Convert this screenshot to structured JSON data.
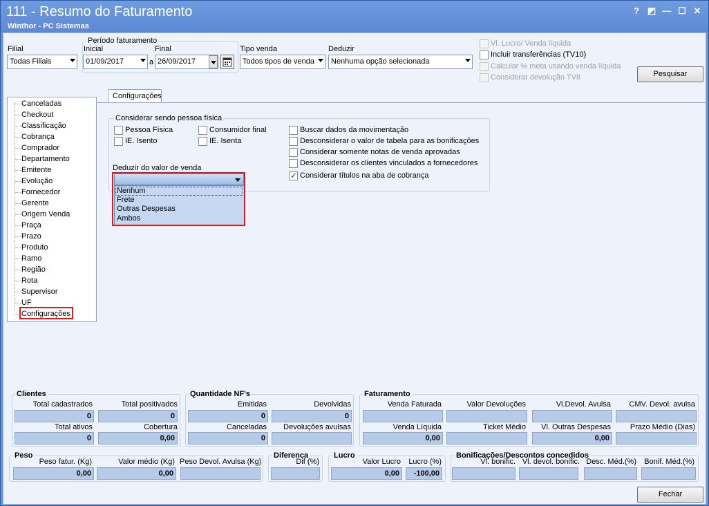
{
  "window": {
    "title": "111 - Resumo do Faturamento",
    "subtitle": "Winthor - PC Sistemas",
    "controls": [
      "?",
      "◩",
      "—",
      "☐",
      "✕"
    ]
  },
  "filters": {
    "filial_label": "Filial",
    "filial_value": "Todas Filiais",
    "periodo_label": "Período faturamento",
    "inicial_label": "Inicial",
    "inicial_value": "01/09/2017",
    "a_label": "a",
    "final_label": "Final",
    "final_value": "26/09/2017",
    "tipo_venda_label": "Tipo venda",
    "tipo_venda_value": "Todos tipos de venda",
    "deduzir_label": "Deduzir",
    "deduzir_value": "Nenhuma opção selecionada",
    "checks": [
      {
        "label": "Vl. Lucro/ Venda líquida",
        "checked": false,
        "enabled": false
      },
      {
        "label": "Incluir transferências  (TV10)",
        "checked": false,
        "enabled": true
      },
      {
        "label": "Calcular % meta usando venda líquida",
        "checked": false,
        "enabled": false
      },
      {
        "label": "Considerar devolução TV8",
        "checked": false,
        "enabled": false
      }
    ],
    "pesquisar_label": "Pesquisar"
  },
  "tree": {
    "items": [
      "Canceladas",
      "Checkout",
      "Classificação",
      "Cobrança",
      "Comprador",
      "Departamento",
      "Emitente",
      "Evolução",
      "Fornecedor",
      "Gerente",
      "Origem Venda",
      "Praça",
      "Prazo",
      "Produto",
      "Ramo",
      "Região",
      "Rota",
      "Supervisor",
      "UF",
      "Configurações"
    ],
    "selected": "Configurações"
  },
  "config": {
    "tab_label": "Configurações",
    "pessoa_group_label": "Considerar sendo pessoa física",
    "pessoa_checks": [
      {
        "label": "Pessoa Física",
        "checked": false
      },
      {
        "label": "Consumidor final",
        "checked": false
      },
      {
        "label": "IE. Isento",
        "checked": false
      },
      {
        "label": "IE. Isenta",
        "checked": false
      }
    ],
    "right_checks": [
      {
        "label": "Buscar dados da movimentação",
        "checked": false
      },
      {
        "label": "Desconsiderar o valor de tabela para as bonificações",
        "checked": false
      },
      {
        "label": "Considerar somente notas de venda aprovadas",
        "checked": false
      },
      {
        "label": "Desconsiderar os clientes vinculados a fornecedores",
        "checked": false
      },
      {
        "label": "Considerar títulos na aba de cobrança",
        "checked": true
      }
    ],
    "deduzir_venda_label": "Deduzir do valor de venda",
    "deduzir_venda_value": "",
    "deduzir_options": [
      "Nenhum",
      "Frete",
      "Outras Despesas",
      "Ambos"
    ]
  },
  "clientes": {
    "title": "Clientes",
    "labels": [
      "Total cadastrados",
      "Total positivados",
      "Total ativos",
      "Cobertura"
    ],
    "values": [
      "0",
      "0",
      "0",
      "0,00"
    ]
  },
  "quantidade": {
    "title": "Quantidade NF's",
    "labels": [
      "Emitidas",
      "Devolvidas",
      "Canceladas",
      "Devoluções avulsas"
    ],
    "values": [
      "0",
      "0",
      "0",
      ""
    ]
  },
  "faturamento": {
    "title": "Faturamento",
    "labels": [
      "Venda Faturada",
      "Valor Devoluções",
      "Vl.Devol. Avulsa",
      "CMV. Devol. avulsa",
      "Venda Líquida",
      "Ticket Médio",
      "Vl. Outras Despesas",
      "Prazo Médio (Dias)"
    ],
    "values": [
      "",
      "",
      "",
      "",
      "0,00",
      "",
      "0,00",
      ""
    ]
  },
  "peso": {
    "title": "Peso",
    "labels": [
      "Peso fatur. (Kg)",
      "Valor médio (Kg)",
      "Peso Devol. Avulsa (Kg)"
    ],
    "values": [
      "0,00",
      "0,00",
      ""
    ]
  },
  "diferenca": {
    "title": "Diferenca",
    "labels": [
      "Dif (%)"
    ],
    "values": [
      ""
    ]
  },
  "lucro": {
    "title": "Lucro",
    "labels": [
      "Valor Lucro",
      "Lucro (%)"
    ],
    "values": [
      "0,00",
      "-100,00"
    ]
  },
  "bonificacoes": {
    "title": "Bonificações/Descontos concedidos",
    "labels": [
      "Vl. bonific.",
      "Vl. devol. bonific.",
      "Desc. Méd.(%)",
      "Bonif. Méd.(%)"
    ],
    "values": [
      "",
      "",
      "",
      ""
    ]
  },
  "fechar_label": "Fechar"
}
